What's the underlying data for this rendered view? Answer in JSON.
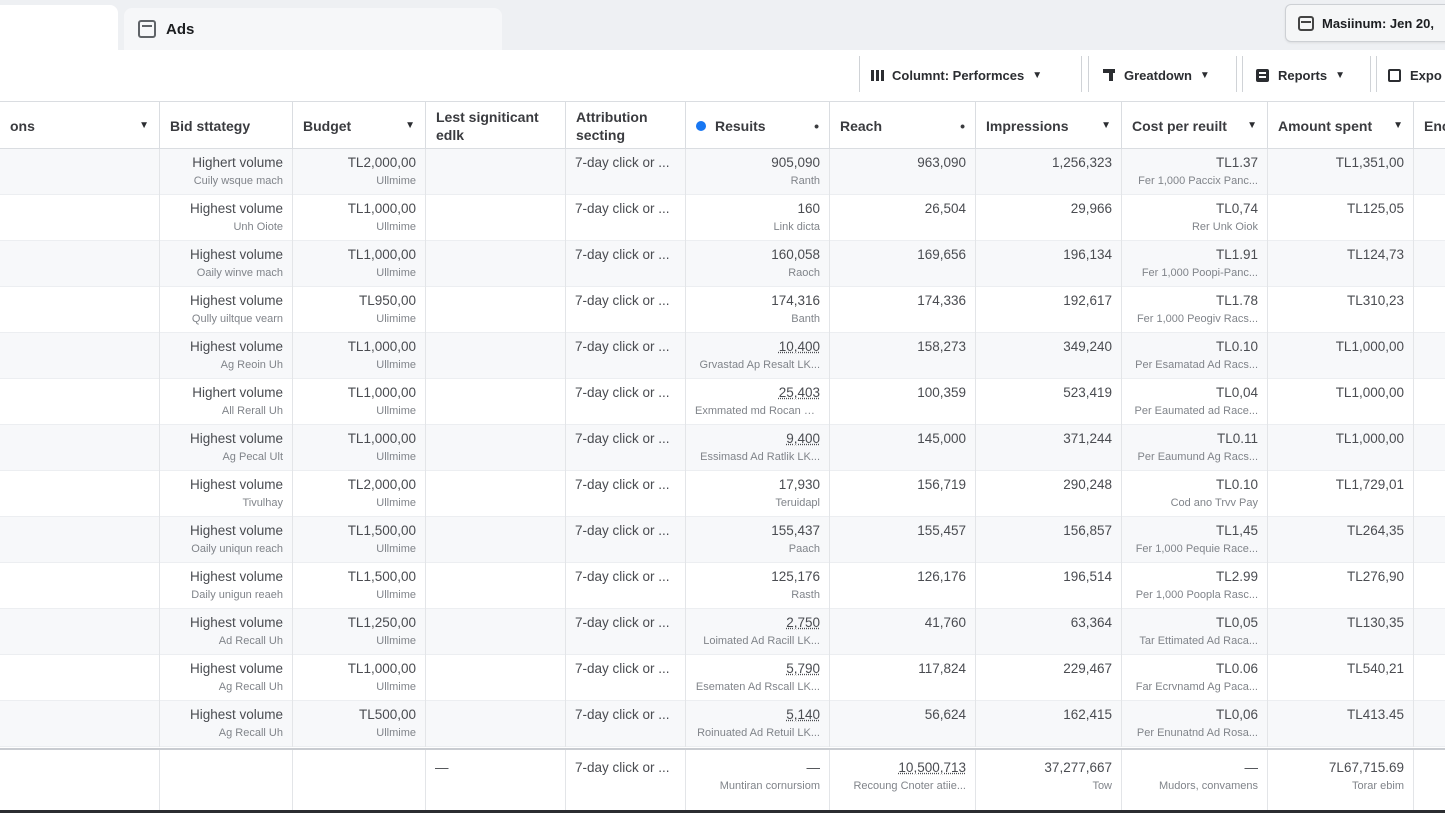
{
  "tabs": {
    "ads_label": "Ads"
  },
  "date_range": {
    "label": "Masiinum: Jen 20,"
  },
  "toolbar": {
    "columns_label": "Columnt: Performces",
    "breakdown_label": "Greatdown",
    "reports_label": "Reports",
    "export_label": "Expo"
  },
  "headers": {
    "col0": "ons",
    "bid": "Bid sttategy",
    "budget": "Budget",
    "edit": "Lest signiticant edlk",
    "attr": "Attribution secting",
    "results": "Resuits",
    "reach": "Reach",
    "impressions": "Impressions",
    "cpr": "Cost per reuilt",
    "spent": "Amount spent",
    "end": "Enc"
  },
  "rows": [
    {
      "bid": "Highert volume",
      "bid_sub": "Cuily wsque mach",
      "budget": "TL2,000,00",
      "budget_sub": "Ullmime",
      "attr": "7-day click or ...",
      "results": "905,090",
      "results_sub": "Ranth",
      "reach": "963,090",
      "impressions": "1,256,323",
      "cpr": "TL1.37",
      "cpr_sub": "Fer 1,000 Paccix Panc...",
      "spent": "TL1,351,00"
    },
    {
      "bid": "Highest volume",
      "bid_sub": "Unh Oiote",
      "budget": "TL1,000,00",
      "budget_sub": "Ullmime",
      "attr": "7-day click or ...",
      "results": "160",
      "results_sub": "Link dicta",
      "reach": "26,504",
      "impressions": "29,966",
      "cpr": "TL0,74",
      "cpr_sub": "Rer Unk Oiok",
      "spent": "TL125,05"
    },
    {
      "bid": "Highest volume",
      "bid_sub": "Oaily winve mach",
      "budget": "TL1,000,00",
      "budget_sub": "Ullmime",
      "attr": "7-day click or ...",
      "results": "160,058",
      "results_sub": "Raoch",
      "reach": "169,656",
      "impressions": "196,134",
      "cpr": "TL1.91",
      "cpr_sub": "Fer 1,000 Poopi-Panc...",
      "spent": "TL124,73"
    },
    {
      "bid": "Highest volume",
      "bid_sub": "Qully uiltque vearn",
      "budget": "TL950,00",
      "budget_sub": "Ulimime",
      "attr": "7-day click or ...",
      "results": "174,316",
      "results_sub": "Banth",
      "reach": "174,336",
      "impressions": "192,617",
      "cpr": "TL1.78",
      "cpr_sub": "Fer 1,000 Peogiv Racs...",
      "spent": "TL310,23"
    },
    {
      "bid": "Highest volume",
      "bid_sub": "Ag Reoin Uh",
      "budget": "TL1,000,00",
      "budget_sub": "Ullmime",
      "attr": "7-day click or ...",
      "results": "10,400",
      "results_sub": "Grvastad Ap Resalt LK...",
      "reach": "158,273",
      "impressions": "349,240",
      "cpr": "TL0.10",
      "cpr_sub": "Per Esamatad Ad Racs...",
      "spent": "TL1,000,00"
    },
    {
      "bid": "Highert volume",
      "bid_sub": "All Rerall Uh",
      "budget": "TL1,000,00",
      "budget_sub": "Ullmime",
      "attr": "7-day click or ...",
      "results": "25,403",
      "results_sub": "Exmmated md Rocan UL...",
      "reach": "100,359",
      "impressions": "523,419",
      "cpr": "TL0,04",
      "cpr_sub": "Per Eaumated ad Race...",
      "spent": "TL1,000,00"
    },
    {
      "bid": "Highest volume",
      "bid_sub": "Ag Pecal Ult",
      "budget": "TL1,000,00",
      "budget_sub": "Ullmime",
      "attr": "7-day click or ...",
      "results": "9,400",
      "results_sub": "Essimasd Ad Ratlik LK...",
      "reach": "145,000",
      "impressions": "371,244",
      "cpr": "TL0.11",
      "cpr_sub": "Per Eaumund Ag Racs...",
      "spent": "TL1,000,00"
    },
    {
      "bid": "Highest volume",
      "bid_sub": "Tivulhay",
      "budget": "TL2,000,00",
      "budget_sub": "Ullmime",
      "attr": "7-day click or ...",
      "results": "17,930",
      "results_sub": "Teruidapl",
      "reach": "156,719",
      "impressions": "290,248",
      "cpr": "TL0.10",
      "cpr_sub": "Cod ano Trvv Pay",
      "spent": "TL1,729,01"
    },
    {
      "bid": "Highest volume",
      "bid_sub": "Oaily uniqun reach",
      "budget": "TL1,500,00",
      "budget_sub": "Ullmime",
      "attr": "7-day click or ...",
      "results": "155,437",
      "results_sub": "Paach",
      "reach": "155,457",
      "impressions": "156,857",
      "cpr": "TL1,45",
      "cpr_sub": "Fer 1,000 Pequie Race...",
      "spent": "TL264,35"
    },
    {
      "bid": "Highest volume",
      "bid_sub": "Daily unigun reaeh",
      "budget": "TL1,500,00",
      "budget_sub": "Ullmime",
      "attr": "7-day click or ...",
      "results": "125,176",
      "results_sub": "Rasth",
      "reach": "126,176",
      "impressions": "196,514",
      "cpr": "TL2.99",
      "cpr_sub": "Per 1,000 Poopla Rasc...",
      "spent": "TL276,90"
    },
    {
      "bid": "Highest volume",
      "bid_sub": "Ad Recall Uh",
      "budget": "TL1,250,00",
      "budget_sub": "Ullmime",
      "attr": "7-day click or ...",
      "results": "2,750",
      "results_sub": "Loimated Ad Racill LK...",
      "reach": "41,760",
      "impressions": "63,364",
      "cpr": "TL0,05",
      "cpr_sub": "Tar Ettimated Ad Raca...",
      "spent": "TL130,35"
    },
    {
      "bid": "Highest volume",
      "bid_sub": "Ag Recall Uh",
      "budget": "TL1,000,00",
      "budget_sub": "Ullmime",
      "attr": "7-day click or ...",
      "results": "5,790",
      "results_sub": "Esematen Ad Rscall LK...",
      "reach": "117,824",
      "impressions": "229,467",
      "cpr": "TL0.06",
      "cpr_sub": "Far Ecrvnamd Ag Paca...",
      "spent": "TL540,21"
    },
    {
      "bid": "Highest volume",
      "bid_sub": "Ag Recall Uh",
      "budget": "TL500,00",
      "budget_sub": "Ullmime",
      "attr": "7-day click or ...",
      "results": "5,140",
      "results_sub": "Roinuated Ad Retuil LK...",
      "reach": "56,624",
      "impressions": "162,415",
      "cpr": "TL0,06",
      "cpr_sub": "Per Enunatnd Ad Rosa...",
      "spent": "TL413.45"
    }
  ],
  "totals": {
    "edit": "—",
    "attr": "7-day click or ...",
    "results": "—",
    "results_sub": "Muntiran cornursiom",
    "reach": "10,500,713",
    "reach_sub": "Recoung Cnoter atiie...",
    "impressions": "37,277,667",
    "impressions_sub": "Tow",
    "cpr": "—",
    "cpr_sub": "Mudors, convamens",
    "spent": "7L67,715.69",
    "spent_sub": "Torar ebim"
  }
}
